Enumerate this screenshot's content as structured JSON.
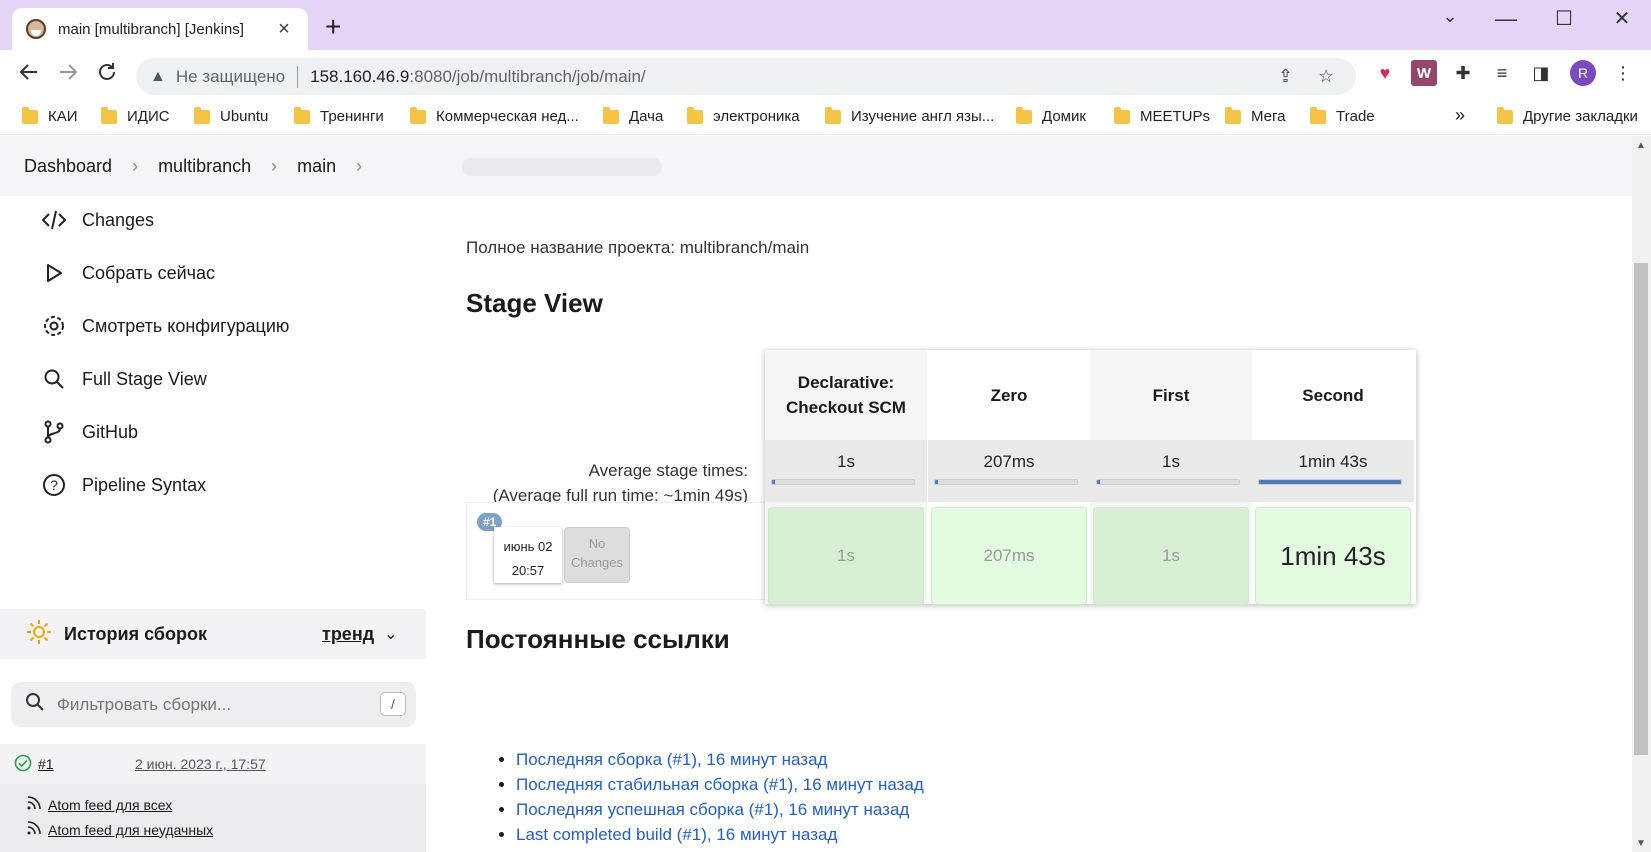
{
  "tab": {
    "title": "main [multibranch] [Jenkins]",
    "close": "×",
    "new_tab": "+"
  },
  "window": {
    "minimize": "—",
    "maximize": "☐",
    "close": "✕",
    "menu": "⌄"
  },
  "address": {
    "not_secure": "Не защищено",
    "host": "158.160.46.9",
    "path": ":8080/job/multibranch/job/main/"
  },
  "bookmarks": [
    "КАИ",
    "ИДИС",
    "Ubuntu",
    "Тренинги",
    "Коммерческая нед...",
    "Дача",
    "электроника",
    "Изучение англ язы...",
    "Домик",
    "MEETUPs",
    "Мега",
    "Trade"
  ],
  "bookmarks_more": "»",
  "bookmarks_other": "Другие закладки",
  "profile_initial": "R",
  "breadcrumb": [
    "Dashboard",
    "multibranch",
    "main"
  ],
  "sidebar": {
    "items": [
      {
        "label": "Changes",
        "icon": "code-icon"
      },
      {
        "label": "Собрать сейчас",
        "icon": "play-icon"
      },
      {
        "label": "Смотреть конфигурацию",
        "icon": "gear-icon"
      },
      {
        "label": "Full Stage View",
        "icon": "search-icon"
      },
      {
        "label": "GitHub",
        "icon": "branch-icon"
      },
      {
        "label": "Pipeline Syntax",
        "icon": "help-icon"
      }
    ],
    "history_title": "История сборок",
    "trend_label": "тренд",
    "filter_placeholder": "Фильтровать сборки...",
    "filter_key": "/",
    "builds": [
      {
        "number": "#1",
        "date": "2 июн. 2023 г., 17:57",
        "status": "success"
      }
    ],
    "feeds": [
      "Atom feed для всех",
      "Atom feed для неудачных"
    ]
  },
  "main": {
    "full_name": "Полное название проекта: multibranch/main",
    "stage_view_title": "Stage View",
    "avg_label_1": "Average stage times:",
    "avg_label_2_pre": "(Average ",
    "avg_label_2_link": "full",
    "avg_label_2_post": " run time: ~1min 49s)",
    "run": {
      "badge": "#1",
      "date": "июнь 02",
      "time": "20:57",
      "no_changes_1": "No",
      "no_changes_2": "Changes"
    },
    "stages": [
      {
        "name": "Declarative: Checkout SCM",
        "avg": "1s",
        "avg_fraction": 0.01,
        "cell": "1s"
      },
      {
        "name": "Zero",
        "avg": "207ms",
        "avg_fraction": 0.01,
        "cell": "207ms"
      },
      {
        "name": "First",
        "avg": "1s",
        "avg_fraction": 0.01,
        "cell": "1s"
      },
      {
        "name": "Second",
        "avg": "1min 43s",
        "avg_fraction": 1.0,
        "cell": "1min 43s"
      }
    ],
    "permalinks_title": "Постоянные ссылки",
    "permalinks": [
      "Последняя сборка (#1), 16 минут назад",
      "Последняя стабильная сборка (#1), 16 минут назад",
      "Последняя успешная сборка (#1), 16 минут назад",
      "Last completed build (#1), 16 минут назад"
    ]
  },
  "colors": {
    "tabstrip": "#e4d4f6",
    "stage_success": "#e2fbe0",
    "avg_bar": "#4b7bbd",
    "link": "#1e5ed8"
  }
}
